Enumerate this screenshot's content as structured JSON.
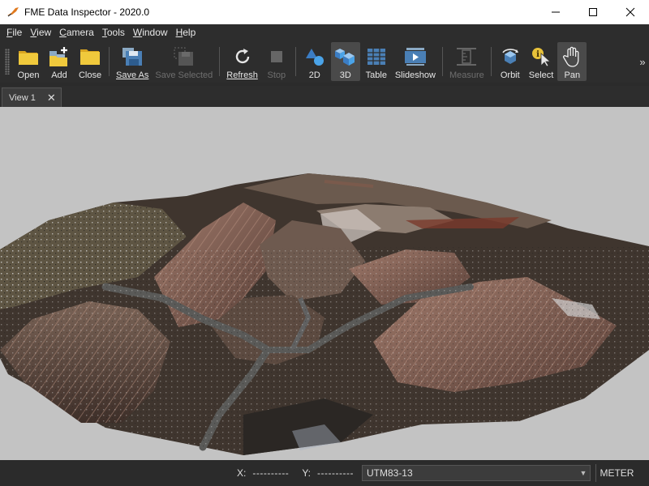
{
  "window": {
    "title": "FME Data Inspector - 2020.0"
  },
  "menu": {
    "file": {
      "acc": "F",
      "rest": "ile"
    },
    "view": {
      "acc": "V",
      "rest": "iew"
    },
    "camera": {
      "acc": "C",
      "rest": "amera"
    },
    "tools": {
      "acc": "T",
      "rest": "ools"
    },
    "window": {
      "acc": "W",
      "rest": "indow"
    },
    "help": {
      "acc": "H",
      "rest": "elp"
    }
  },
  "toolbar": {
    "open": "Open",
    "add": "Add",
    "close": "Close",
    "save_as": "Save As",
    "save_selected": "Save Selected",
    "refresh": "Refresh",
    "stop": "Stop",
    "view_2d": "2D",
    "view_3d": "3D",
    "table": "Table",
    "slideshow": "Slideshow",
    "measure": "Measure",
    "orbit": "Orbit",
    "select": "Select",
    "pan": "Pan",
    "overflow": "»",
    "active_tool": "Pan",
    "active_view": "3D"
  },
  "tabs": [
    {
      "label": "View 1",
      "close": "✕"
    }
  ],
  "statusbar": {
    "x_label": "X:",
    "x_value": "----------",
    "y_label": "Y:",
    "y_value": "----------",
    "crs": "UTM83-13",
    "units": "METER"
  },
  "colors": {
    "accent_blue": "#4aa3e8",
    "folder_yellow": "#e8c23a",
    "background_view": "#c3c3c3"
  }
}
